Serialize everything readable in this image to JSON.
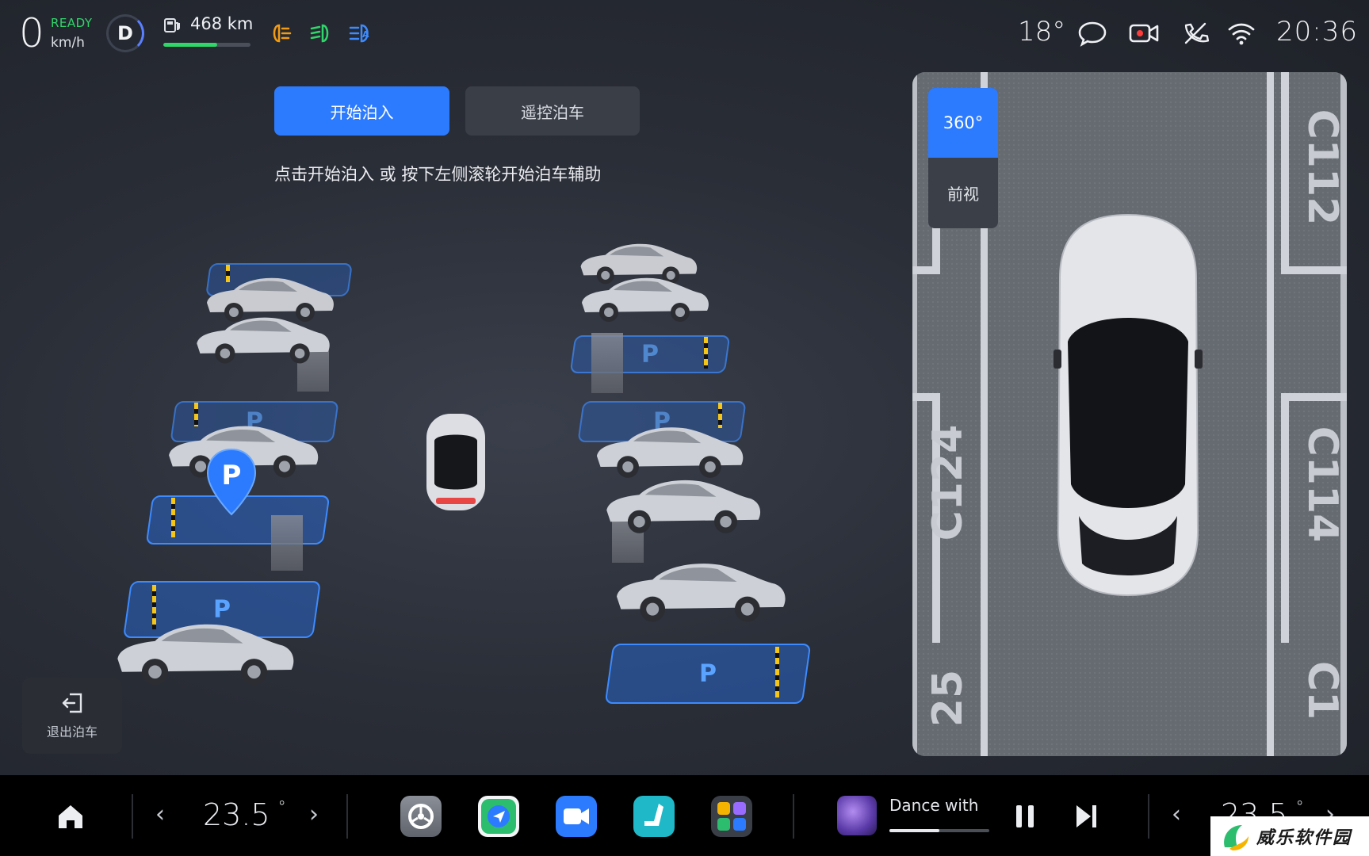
{
  "status_bar": {
    "speed": "0",
    "ready_label": "READY",
    "speed_unit": "km/h",
    "gear": "D",
    "range": "468 km",
    "range_fraction": 0.62,
    "outside_temp": "18°",
    "clock": "20:36",
    "colors": {
      "ready": "#2fd66a",
      "low_beam": "#f39c12",
      "high_beam": "#2fd66a",
      "auto_beam": "#3d8bff"
    },
    "icons": [
      "low-beam-icon",
      "parking-light-icon",
      "auto-high-beam-icon",
      "message-icon",
      "camera-recording-icon",
      "phone-icon",
      "wifi-icon"
    ]
  },
  "parking": {
    "start_button": "开始泊入",
    "remote_button": "遥控泊车",
    "hint": "点击开始泊入 或 按下左侧滚轮开始泊车辅助",
    "slot_label": "P",
    "exit_label": "退出泊车"
  },
  "camera": {
    "tab_360": "360°",
    "tab_front": "前视",
    "bay_labels": [
      "C112",
      "C124",
      "C114",
      "25",
      "C1"
    ]
  },
  "dock": {
    "temp_left": "23.5",
    "temp_right": "23.5",
    "degree": "°",
    "arrow_left": "‹",
    "arrow_right": "›",
    "music_title": "Dance with",
    "music_progress": 0.5,
    "apps": [
      "settings-icon",
      "navigation-icon",
      "video-call-icon",
      "seat-icon",
      "app-group-icon"
    ]
  },
  "watermark": {
    "text": "威乐软件园"
  }
}
